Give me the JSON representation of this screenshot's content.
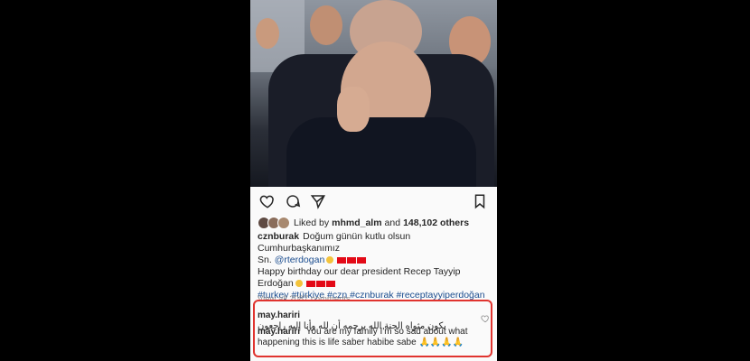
{
  "post": {
    "likes_prefix": "Liked by",
    "liker": "mhmd_alm",
    "likes_mid": "and",
    "likes_count": "148,102 others",
    "caption_user": "cznburak",
    "caption_line1": "Doğum günün kutlu olsun Cumhurbaşkanımız",
    "caption_mention_prefix": "Sn.",
    "caption_mention": "@rterdogan",
    "caption_line3": "Happy birthday our dear president Recep Tayyip",
    "caption_line4": "Erdoğan",
    "hashtags": "#turkey #türkiye #czn #cznburak #receptayyiperdoğan",
    "view_all": "View all 2087 comments"
  },
  "comments": [
    {
      "user": "may.hariri",
      "text": "يكون مثواه الجنة الله يرحمه أن لله وأنا إليه راجعون"
    },
    {
      "user": "may.hariri",
      "text": "You are my family I'm so sad about what happening  this is life saber habibe sabe 🙏🙏🙏🙏"
    }
  ],
  "colors": {
    "highlight_border": "#e0342f",
    "hashtag_blue": "#1b4d8f"
  },
  "icons": [
    "heart-icon",
    "comment-icon",
    "share-icon",
    "bookmark-icon"
  ]
}
